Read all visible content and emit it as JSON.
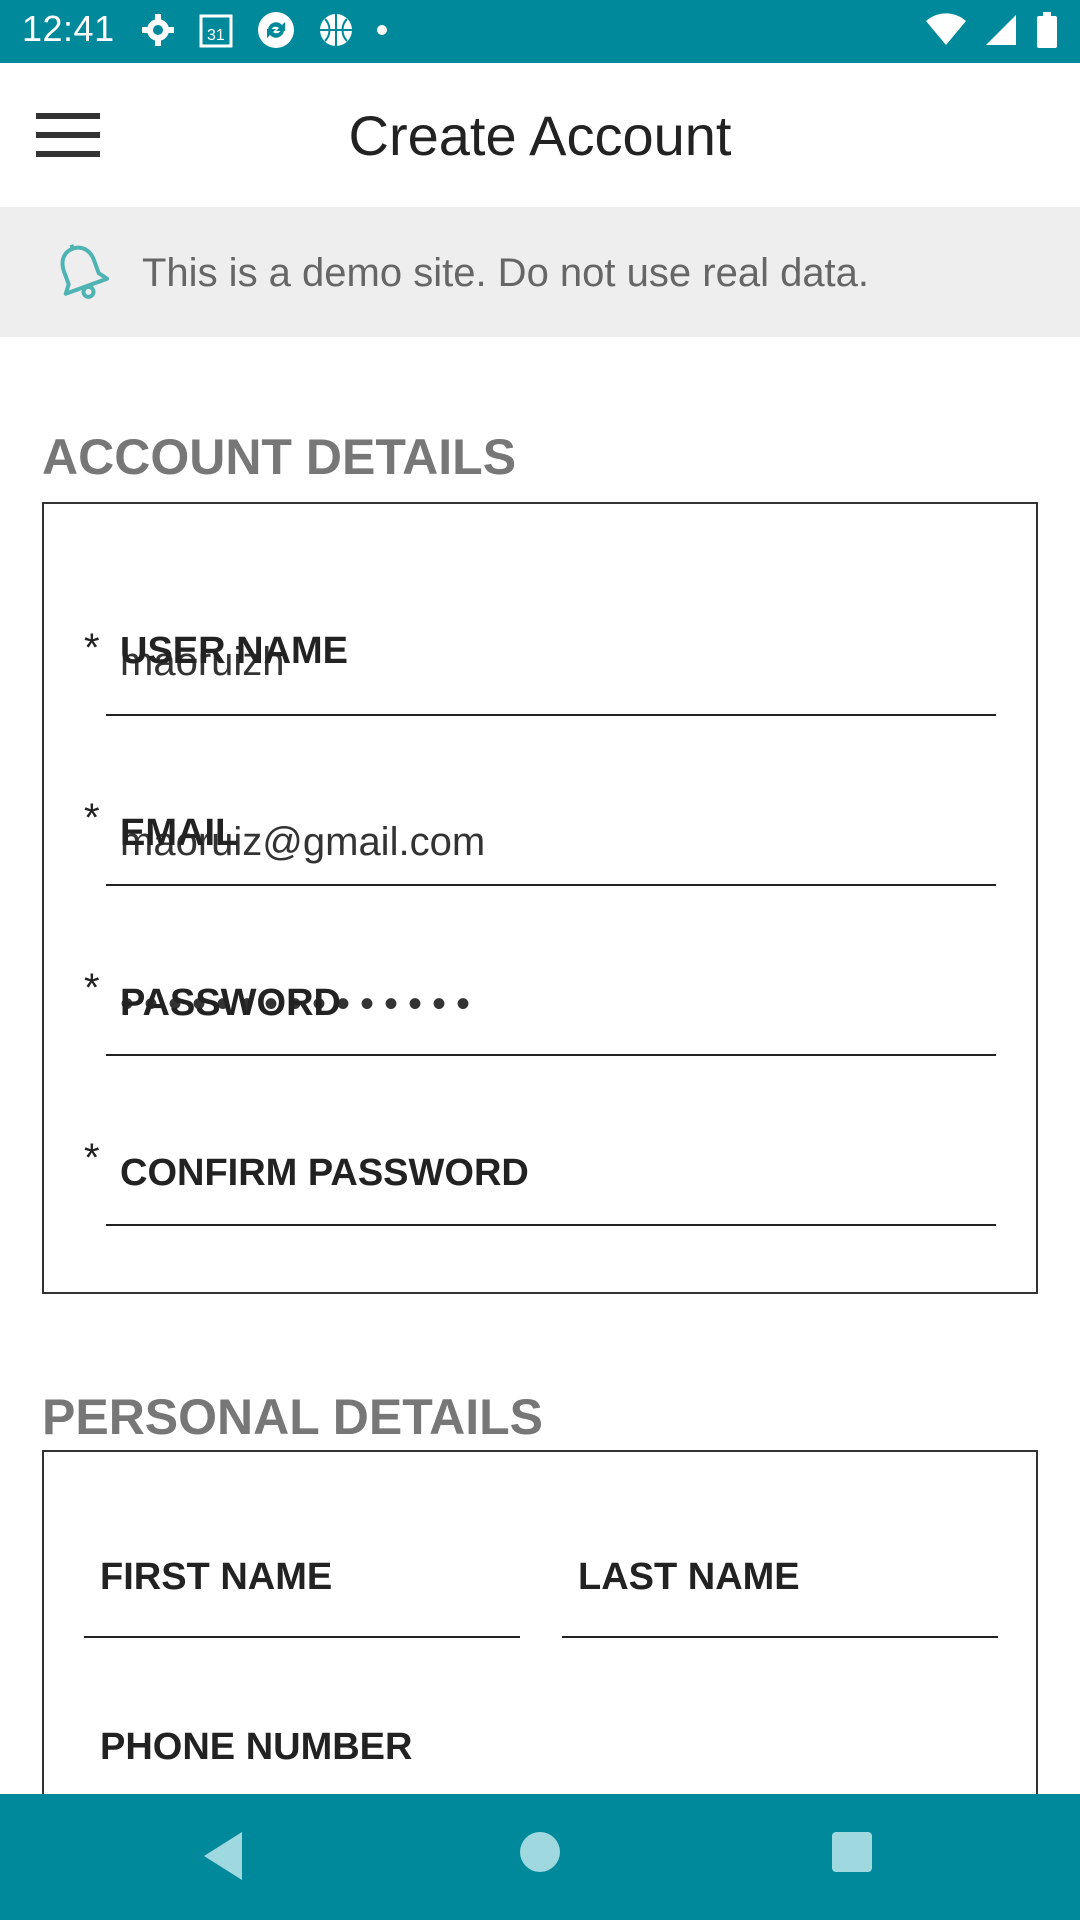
{
  "status_bar": {
    "time": "12:41",
    "icons_left": [
      "gear-icon",
      "calendar-31-icon",
      "sync-icon",
      "basketball-icon",
      "dot-icon"
    ],
    "icons_right": [
      "wifi-icon",
      "signal-icon",
      "battery-icon"
    ]
  },
  "app_bar": {
    "title": "Create Account",
    "menu_icon": "hamburger-menu-icon"
  },
  "banner": {
    "text": "This is a demo site. Do not use real data.",
    "icon": "bell-icon",
    "accent_color": "#4fb3b3"
  },
  "account_section": {
    "title": "ACCOUNT DETAILS",
    "fields": [
      {
        "required_mark": "*",
        "label": "USER NAME",
        "value": "maoruizh"
      },
      {
        "required_mark": "*",
        "label": "EMAIL",
        "value": "maoruiz@gmail.com"
      },
      {
        "required_mark": "*",
        "label": "PASSWORD",
        "value": "•••••••••••••••"
      },
      {
        "required_mark": "*",
        "label": "CONFIRM PASSWORD",
        "value": ""
      }
    ]
  },
  "personal_section": {
    "title": "PERSONAL DETAILS",
    "first_name_label": "FIRST NAME",
    "last_name_label": "LAST NAME",
    "phone_label": "PHONE NUMBER"
  },
  "nav_bar": {
    "back_icon": "back-triangle-icon",
    "home_icon": "home-circle-icon",
    "recents_icon": "recents-square-icon"
  },
  "colors": {
    "primary": "#00899a",
    "banner_bg": "#eeeeee",
    "section_title": "#777777"
  }
}
